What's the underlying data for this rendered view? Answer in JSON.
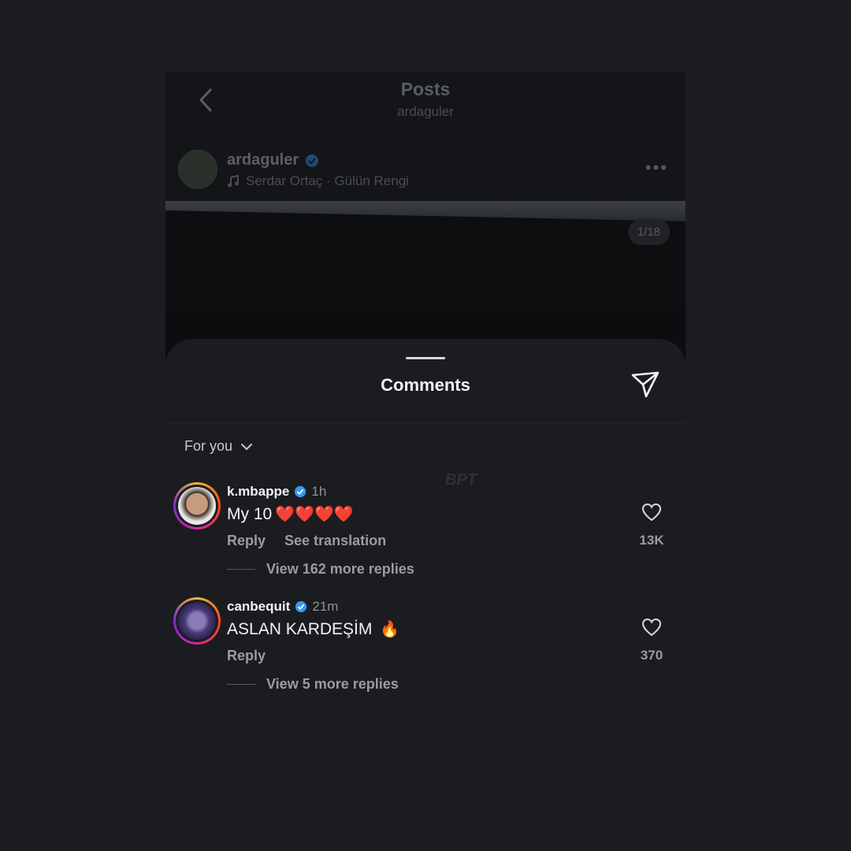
{
  "header": {
    "title": "Posts",
    "subtitle": "ardaguler"
  },
  "post": {
    "author": "ardaguler",
    "music": "Serdar Ortaç · Gülün Rengi",
    "counter": "1/18"
  },
  "comments_sheet": {
    "title": "Comments",
    "filter_label": "For you",
    "watermark": "BPT",
    "comments": [
      {
        "username": "k.mbappe",
        "time": "1h",
        "text": "My 10",
        "emoji": "❤️❤️❤️❤️",
        "reply_label": "Reply",
        "translate_label": "See translation",
        "replies_label": "View 162 more replies",
        "likes": "13K"
      },
      {
        "username": "canbequit",
        "time": "21m",
        "text": "ASLAN KARDEŞİM",
        "emoji": "🔥",
        "reply_label": "Reply",
        "replies_label": "View 5 more replies",
        "likes": "370"
      }
    ]
  },
  "colors": {
    "background": "#1b1c20",
    "verified": "#3897f0",
    "heart": "#e0243a"
  }
}
